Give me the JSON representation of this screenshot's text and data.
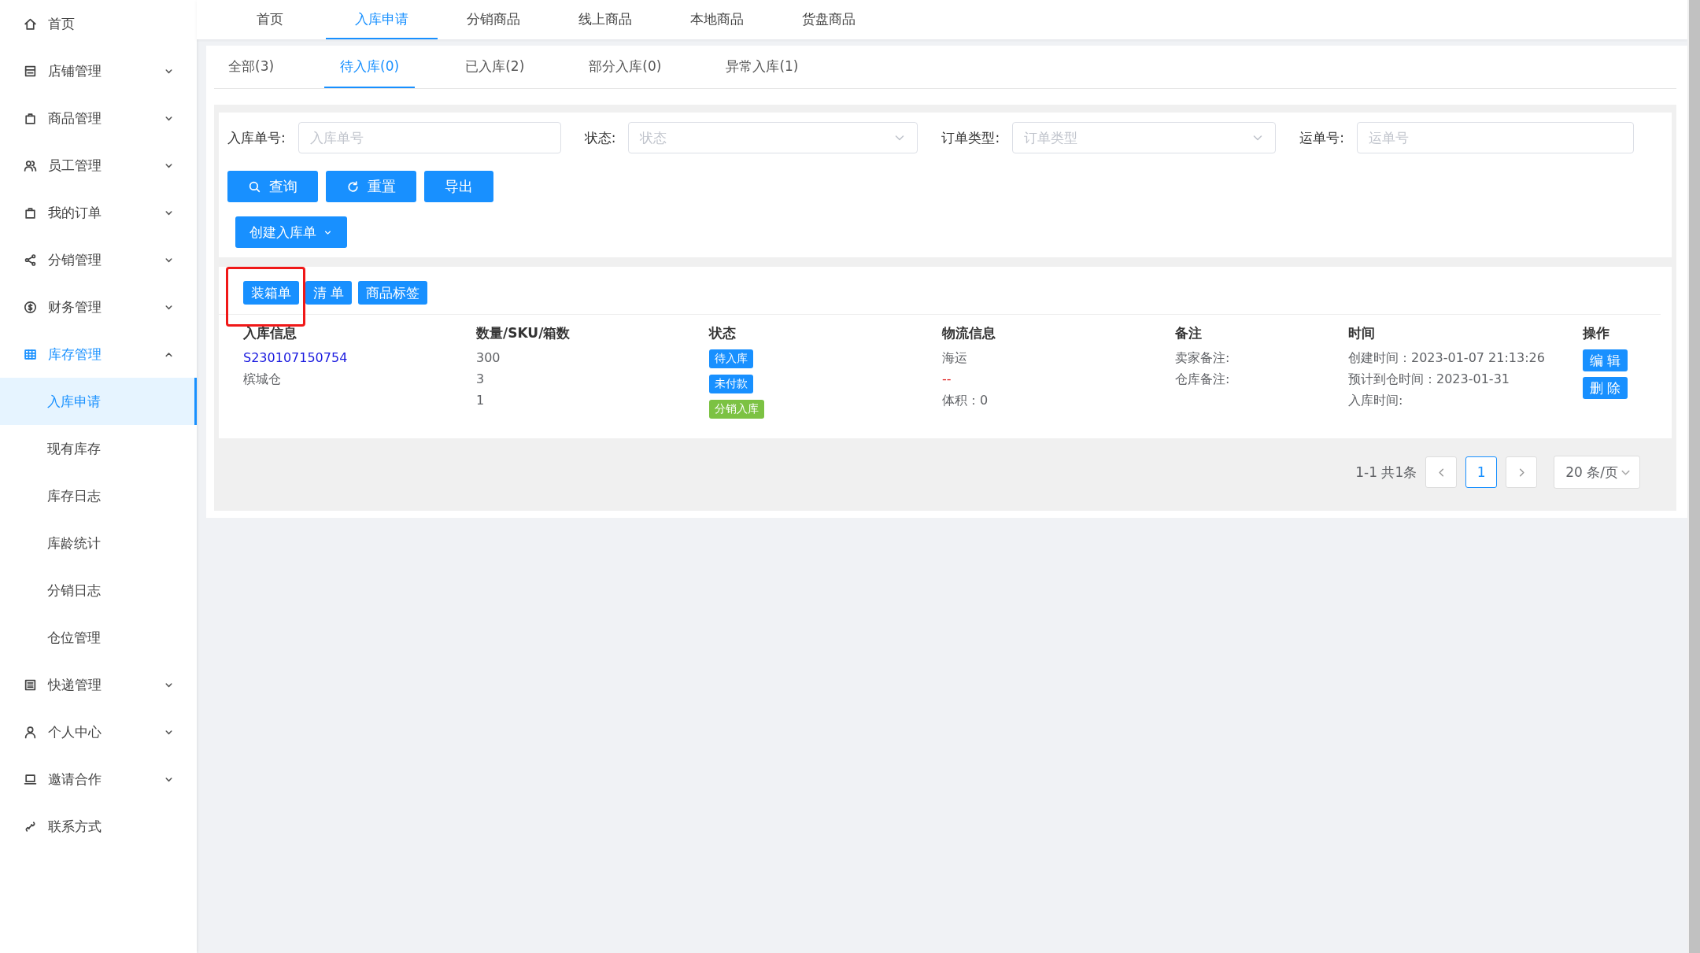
{
  "sidebar": {
    "items": [
      {
        "label": "首页"
      },
      {
        "label": "店铺管理",
        "expanded": false
      },
      {
        "label": "商品管理",
        "expanded": false
      },
      {
        "label": "员工管理",
        "expanded": false
      },
      {
        "label": "我的订单",
        "expanded": false
      },
      {
        "label": "分销管理",
        "expanded": false
      },
      {
        "label": "财务管理",
        "expanded": false
      },
      {
        "label": "库存管理",
        "expanded": true,
        "selected": true,
        "children": [
          {
            "label": "入库申请",
            "selected": true
          },
          {
            "label": "现有库存",
            "selected": false
          },
          {
            "label": "库存日志",
            "selected": false
          },
          {
            "label": "库龄统计",
            "selected": false
          },
          {
            "label": "分销日志",
            "selected": false
          },
          {
            "label": "仓位管理",
            "selected": false
          }
        ]
      },
      {
        "label": "快递管理",
        "expanded": false
      },
      {
        "label": "个人中心",
        "expanded": false
      },
      {
        "label": "邀请合作",
        "expanded": false
      },
      {
        "label": "联系方式"
      }
    ]
  },
  "top_tabs": [
    {
      "label": "首页",
      "selected": false
    },
    {
      "label": "入库申请",
      "selected": true
    },
    {
      "label": "分销商品",
      "selected": false
    },
    {
      "label": "线上商品",
      "selected": false
    },
    {
      "label": "本地商品",
      "selected": false
    },
    {
      "label": "货盘商品",
      "selected": false
    }
  ],
  "status_tabs": [
    {
      "label": "全部(3)",
      "selected": false
    },
    {
      "label": "待入库(0)",
      "selected": true
    },
    {
      "label": "已入库(2)",
      "selected": false
    },
    {
      "label": "部分入库(0)",
      "selected": false
    },
    {
      "label": "异常入库(1)",
      "selected": false
    }
  ],
  "filters": [
    {
      "kind": "input",
      "label": "入库单号:",
      "placeholder": "入库单号"
    },
    {
      "kind": "select",
      "label": "状态:",
      "placeholder": "状态"
    },
    {
      "kind": "select",
      "label": "订单类型:",
      "placeholder": "订单类型"
    },
    {
      "kind": "input",
      "label": "运单号:",
      "placeholder": "运单号"
    }
  ],
  "filter_buttons": [
    {
      "kind": "search",
      "label": "查询"
    },
    {
      "kind": "reset",
      "label": "重置"
    },
    {
      "kind": "plain",
      "label": "导出"
    }
  ],
  "create_button": {
    "label": "创建入库单"
  },
  "print_buttons": [
    {
      "label": "装箱单",
      "highlighted": true
    },
    {
      "label": "清 单",
      "highlighted": false
    },
    {
      "label": "商品标签",
      "highlighted": false
    }
  ],
  "table": {
    "columns": [
      "入库信息",
      "数量/SKU/箱数",
      "状态",
      "物流信息",
      "备注",
      "时间",
      "操作"
    ],
    "rows": [
      {
        "order_no": "S230107150754",
        "warehouse": "槟城仓",
        "quantities": [
          "300",
          "3",
          "1"
        ],
        "tags": [
          {
            "label": "待入库",
            "color": "#1890ff"
          },
          {
            "label": "未付款",
            "color": "#1890ff"
          },
          {
            "label": "分销入库",
            "color": "#7cc243"
          }
        ],
        "logistics": [
          {
            "text": "海运",
            "kind": "normal"
          },
          {
            "text": "--",
            "kind": "alert"
          },
          {
            "text": "体积：0",
            "kind": "normal"
          }
        ],
        "remarks": [
          "卖家备注:",
          "仓库备注:"
        ],
        "times": [
          "创建时间：2023-01-07 21:13:26",
          "预计到仓时间：2023-01-31",
          "入库时间:"
        ],
        "actions": [
          "编 辑",
          "删 除"
        ]
      }
    ]
  },
  "pagination": {
    "summary": "1-1 共1条",
    "pages": [
      {
        "label": "1",
        "selected": true
      }
    ],
    "page_size": "20 条/页"
  }
}
